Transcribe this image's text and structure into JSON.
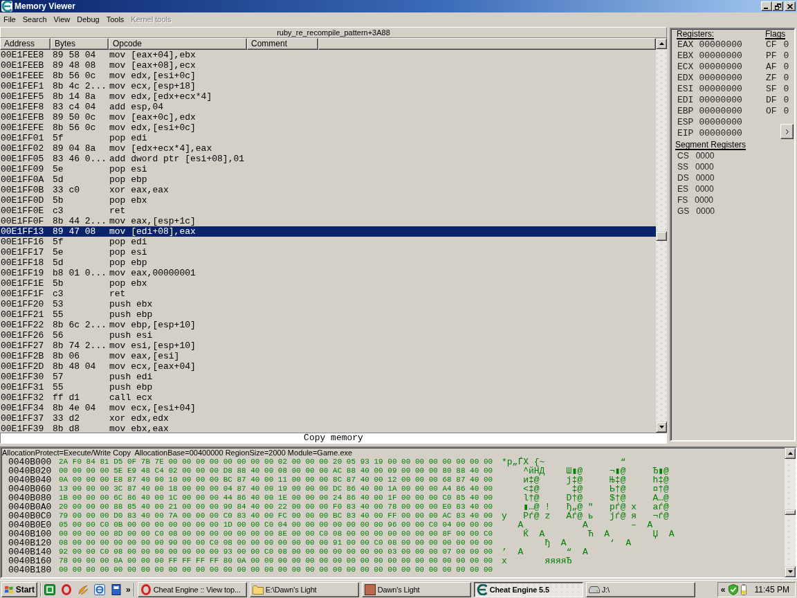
{
  "window": {
    "title": "Memory Viewer"
  },
  "menu": [
    {
      "label": "File",
      "disabled": false
    },
    {
      "label": "Search",
      "disabled": false
    },
    {
      "label": "View",
      "disabled": false
    },
    {
      "label": "Debug",
      "disabled": false
    },
    {
      "label": "Tools",
      "disabled": false
    },
    {
      "label": "Kernel tools",
      "disabled": true
    }
  ],
  "disassembler": {
    "location": "ruby_re_recompile_pattern+3A88",
    "columns": [
      "Address",
      "Bytes",
      "Opcode",
      "Comment"
    ],
    "rows": [
      {
        "address": "00E1FEE8",
        "bytes": "89 58 04",
        "opcode": "mov [eax+04],ebx",
        "selected": false
      },
      {
        "address": "00E1FEEB",
        "bytes": "89 48 08",
        "opcode": "mov [eax+08],ecx",
        "selected": false
      },
      {
        "address": "00E1FEEE",
        "bytes": "8b 56 0c",
        "opcode": "mov edx,[esi+0c]",
        "selected": false
      },
      {
        "address": "00E1FEF1",
        "bytes": "8b 4c 2...",
        "opcode": "mov ecx,[esp+18]",
        "selected": false
      },
      {
        "address": "00E1FEF5",
        "bytes": "8b 14 8a",
        "opcode": "mov edx,[edx+ecx*4]",
        "selected": false
      },
      {
        "address": "00E1FEF8",
        "bytes": "83 c4 04",
        "opcode": "add esp,04",
        "selected": false
      },
      {
        "address": "00E1FEFB",
        "bytes": "89 50 0c",
        "opcode": "mov [eax+0c],edx",
        "selected": false
      },
      {
        "address": "00E1FEFE",
        "bytes": "8b 56 0c",
        "opcode": "mov edx,[esi+0c]",
        "selected": false
      },
      {
        "address": "00E1FF01",
        "bytes": "5f",
        "opcode": "pop edi",
        "selected": false
      },
      {
        "address": "00E1FF02",
        "bytes": "89 04 8a",
        "opcode": "mov [edx+ecx*4],eax",
        "selected": false
      },
      {
        "address": "00E1FF05",
        "bytes": "83 46 0...",
        "opcode": "add dword ptr [esi+08],01",
        "selected": false
      },
      {
        "address": "00E1FF09",
        "bytes": "5e",
        "opcode": "pop esi",
        "selected": false
      },
      {
        "address": "00E1FF0A",
        "bytes": "5d",
        "opcode": "pop ebp",
        "selected": false
      },
      {
        "address": "00E1FF0B",
        "bytes": "33 c0",
        "opcode": "xor eax,eax",
        "selected": false
      },
      {
        "address": "00E1FF0D",
        "bytes": "5b",
        "opcode": "pop ebx",
        "selected": false
      },
      {
        "address": "00E1FF0E",
        "bytes": "c3",
        "opcode": "ret",
        "selected": false
      },
      {
        "address": "00E1FF0F",
        "bytes": "8b 44 2...",
        "opcode": "mov eax,[esp+1c]",
        "selected": false
      },
      {
        "address": "00E1FF13",
        "bytes": "89 47 08",
        "opcode": "mov [edi+08],eax",
        "selected": true
      },
      {
        "address": "00E1FF16",
        "bytes": "5f",
        "opcode": "pop edi",
        "selected": false
      },
      {
        "address": "00E1FF17",
        "bytes": "5e",
        "opcode": "pop esi",
        "selected": false
      },
      {
        "address": "00E1FF18",
        "bytes": "5d",
        "opcode": "pop ebp",
        "selected": false
      },
      {
        "address": "00E1FF19",
        "bytes": "b8 01 0...",
        "opcode": "mov eax,00000001",
        "selected": false
      },
      {
        "address": "00E1FF1E",
        "bytes": "5b",
        "opcode": "pop ebx",
        "selected": false
      },
      {
        "address": "00E1FF1F",
        "bytes": "c3",
        "opcode": "ret",
        "selected": false
      },
      {
        "address": "00E1FF20",
        "bytes": "53",
        "opcode": "push ebx",
        "selected": false
      },
      {
        "address": "00E1FF21",
        "bytes": "55",
        "opcode": "push ebp",
        "selected": false
      },
      {
        "address": "00E1FF22",
        "bytes": "8b 6c 2...",
        "opcode": "mov ebp,[esp+10]",
        "selected": false
      },
      {
        "address": "00E1FF26",
        "bytes": "56",
        "opcode": "push esi",
        "selected": false
      },
      {
        "address": "00E1FF27",
        "bytes": "8b 74 2...",
        "opcode": "mov esi,[esp+10]",
        "selected": false
      },
      {
        "address": "00E1FF2B",
        "bytes": "8b 06",
        "opcode": "mov eax,[esi]",
        "selected": false
      },
      {
        "address": "00E1FF2D",
        "bytes": "8b 48 04",
        "opcode": "mov ecx,[eax+04]",
        "selected": false
      },
      {
        "address": "00E1FF30",
        "bytes": "57",
        "opcode": "push edi",
        "selected": false
      },
      {
        "address": "00E1FF31",
        "bytes": "55",
        "opcode": "push ebp",
        "selected": false
      },
      {
        "address": "00E1FF32",
        "bytes": "ff d1",
        "opcode": "call ecx",
        "selected": false
      },
      {
        "address": "00E1FF34",
        "bytes": "8b 4e 04",
        "opcode": "mov ecx,[esi+04]",
        "selected": false
      },
      {
        "address": "00E1FF37",
        "bytes": "33 d2",
        "opcode": "xor edx,edx",
        "selected": false
      },
      {
        "address": "00E1FF39",
        "bytes": "8b d8",
        "opcode": "mov ebx,eax",
        "selected": false
      }
    ],
    "status": "Copy memory"
  },
  "registers": {
    "title": "Registers:",
    "items": [
      {
        "name": "EAX",
        "value": "00000000"
      },
      {
        "name": "EBX",
        "value": "00000000"
      },
      {
        "name": "ECX",
        "value": "00000000"
      },
      {
        "name": "EDX",
        "value": "00000000"
      },
      {
        "name": "ESI",
        "value": "00000000"
      },
      {
        "name": "EDI",
        "value": "00000000"
      },
      {
        "name": "EBP",
        "value": "00000000"
      },
      {
        "name": "ESP",
        "value": "00000000"
      },
      {
        "name": "EIP",
        "value": "00000000"
      }
    ],
    "flags_title": "Flags",
    "flags": [
      {
        "name": "CF",
        "value": "0"
      },
      {
        "name": "PF",
        "value": "0"
      },
      {
        "name": "AF",
        "value": "0"
      },
      {
        "name": "ZF",
        "value": "0"
      },
      {
        "name": "SF",
        "value": "0"
      },
      {
        "name": "DF",
        "value": "0"
      },
      {
        "name": "OF",
        "value": "0"
      }
    ],
    "segment_title": "Segment Registers",
    "segments": [
      {
        "name": "CS",
        "value": "0000"
      },
      {
        "name": "SS",
        "value": "0000"
      },
      {
        "name": "DS",
        "value": "0000"
      },
      {
        "name": "ES",
        "value": "0000"
      },
      {
        "name": "FS",
        "value": "0000"
      },
      {
        "name": "GS",
        "value": "0000"
      }
    ]
  },
  "hex_view": {
    "info": "AllocationProtect=Execute/Write Copy  AllocationBase=00400000 RegionSize=2000 Module=Game.exe",
    "rows": [
      {
        "address": "0040B000",
        "bytes": "2A F0 84 81 D5 0F 7B 7E 00 00 00 00 00 00 00 00 02 00 00 00 20 05 93 19 00 00 00 00 00 00 00 00",
        "ascii": "*р„ЃХ {~              “"
      },
      {
        "address": "0040B020",
        "bytes": "00 00 00 00 5E E9 48 C4 02 00 00 00 D8 88 40 00 08 00 00 00 AC 88 40 00 09 00 00 00 80 88 40 00",
        "ascii": "    ^йHД    Ш▮@     ¬▮@     Ђ▮@"
      },
      {
        "address": "0040B040",
        "bytes": "0A 00 00 00 E8 87 40 00 10 00 00 00 BC 87 40 00 11 00 00 00 8C 87 40 00 12 00 00 00 68 87 40 00",
        "ascii": "    и‡@     ј‡@     Њ‡@     h‡@"
      },
      {
        "address": "0040B060",
        "bytes": "13 00 00 00 3C 87 40 00 18 00 00 00 04 87 40 00 19 00 00 00 DC 86 40 00 1A 00 00 00 A4 86 40 00",
        "ascii": "    <‡@      ‡@     Ь†@     ¤†@"
      },
      {
        "address": "0040B080",
        "bytes": "1B 00 00 00 6C 86 40 00 1C 00 00 00 44 86 40 00 1E 00 00 00 24 86 40 00 1F 00 00 00 C0 85 40 00",
        "ascii": "    l†@     D†@     $†@     А…@"
      },
      {
        "address": "0040B0A0",
        "bytes": "20 00 00 00 88 85 40 00 21 00 00 00 90 84 40 00 22 00 00 00 F0 83 40 00 78 00 00 00 E0 83 40 00",
        "ascii": "    ▮…@ !   ђ„@ \"   рѓ@ x   аѓ@"
      },
      {
        "address": "0040B0C0",
        "bytes": "79 00 00 00 D0 83 40 00 7A 00 00 00 C0 83 40 00 FC 00 00 00 BC 83 40 00 FF 00 00 00 AC 83 40 00",
        "ascii": "y   Рѓ@ z   Аѓ@ ь   јѓ@ я   ¬ѓ@"
      },
      {
        "address": "0040B0E0",
        "bytes": "05 00 00 C0 0B 00 00 00 00 00 00 00 1D 00 00 C0 04 00 00 00 00 00 00 00 96 00 00 C0 04 00 00 00",
        "ascii": "   А           А        –  А"
      },
      {
        "address": "0040B100",
        "bytes": "00 00 00 00 8D 00 00 C0 08 00 00 00 00 00 00 00 8E 00 00 C0 08 00 00 00 00 00 00 00 8F 00 00 C0",
        "ascii": "    Ќ  А        Ћ  А        Џ  А"
      },
      {
        "address": "0040B120",
        "bytes": "08 00 00 00 00 00 00 00 90 00 00 C0 08 00 00 00 00 00 00 00 91 00 00 C0 08 00 00 00 00 00 00 00",
        "ascii": "        ђ  А        ‘  А"
      },
      {
        "address": "0040B140",
        "bytes": "92 00 00 C0 08 00 00 00 00 00 00 00 93 00 00 C0 08 00 00 00 00 00 00 00 03 00 00 00 07 00 00 00",
        "ascii": "’  А        “  А"
      },
      {
        "address": "0040B160",
        "bytes": "78 00 00 00 0A 00 00 00 FF FF FF FF 80 0A 00 00 00 00 00 00 00 00 00 00 00 00 00 00 00 00 00 00",
        "ascii": "x       яяяяЂ"
      },
      {
        "address": "0040B180",
        "bytes": "00 00 00 00 00 00 00 00 00 00 00 00 00 00 00 00 00 00 00 00 00 00 00 00 00 00 00 00 00 00 00 00"
      }
    ]
  },
  "taskbar": {
    "start": "Start",
    "quick_launch_more": "»",
    "tasks": [
      {
        "label": "Cheat Engine :: View top...",
        "selected": false
      },
      {
        "label": "E:\\Dawn's Light",
        "selected": false
      },
      {
        "label": "Dawn's Light",
        "selected": false
      },
      {
        "label": "Cheat Engine 5.5",
        "selected": true
      },
      {
        "label": "J:\\",
        "selected": false
      }
    ],
    "tray_expand": "«",
    "clock": "11:45 PM"
  }
}
